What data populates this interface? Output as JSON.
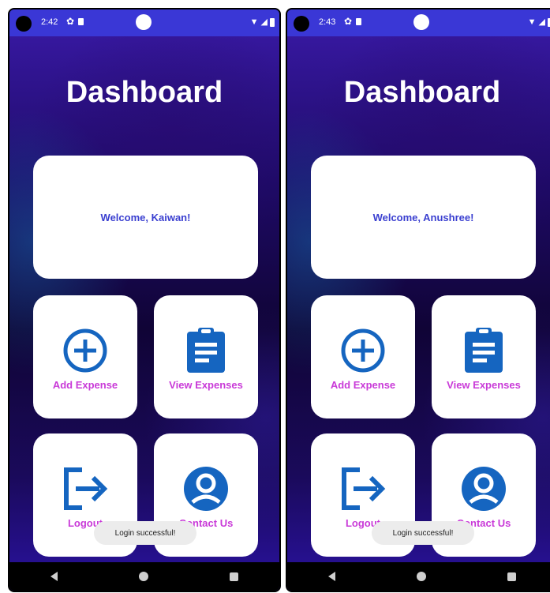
{
  "screens": [
    {
      "status": {
        "time": "2:42"
      },
      "title": "Dashboard",
      "welcome": "Welcome, Kaiwan!",
      "tiles": {
        "add_expense": "Add Expense",
        "view_expenses": "View Expenses",
        "logout": "Logout",
        "contact_us": "Contact Us"
      },
      "toast": "Login successful!"
    },
    {
      "status": {
        "time": "2:43"
      },
      "title": "Dashboard",
      "welcome": "Welcome, Anushree!",
      "tiles": {
        "add_expense": "Add Expense",
        "view_expenses": "View Expenses",
        "logout": "Logout",
        "contact_us": "Contact Us"
      },
      "toast": "Login successful!"
    }
  ],
  "colors": {
    "accent_blue": "#1565c0",
    "status_bar": "#3a37d6",
    "welcome_text": "#3a3fd0",
    "tile_label": "#c93ad8"
  },
  "icons": {
    "add_expense": "add-circle-icon",
    "view_expenses": "clipboard-list-icon",
    "logout": "logout-icon",
    "contact_us": "account-circle-icon"
  }
}
